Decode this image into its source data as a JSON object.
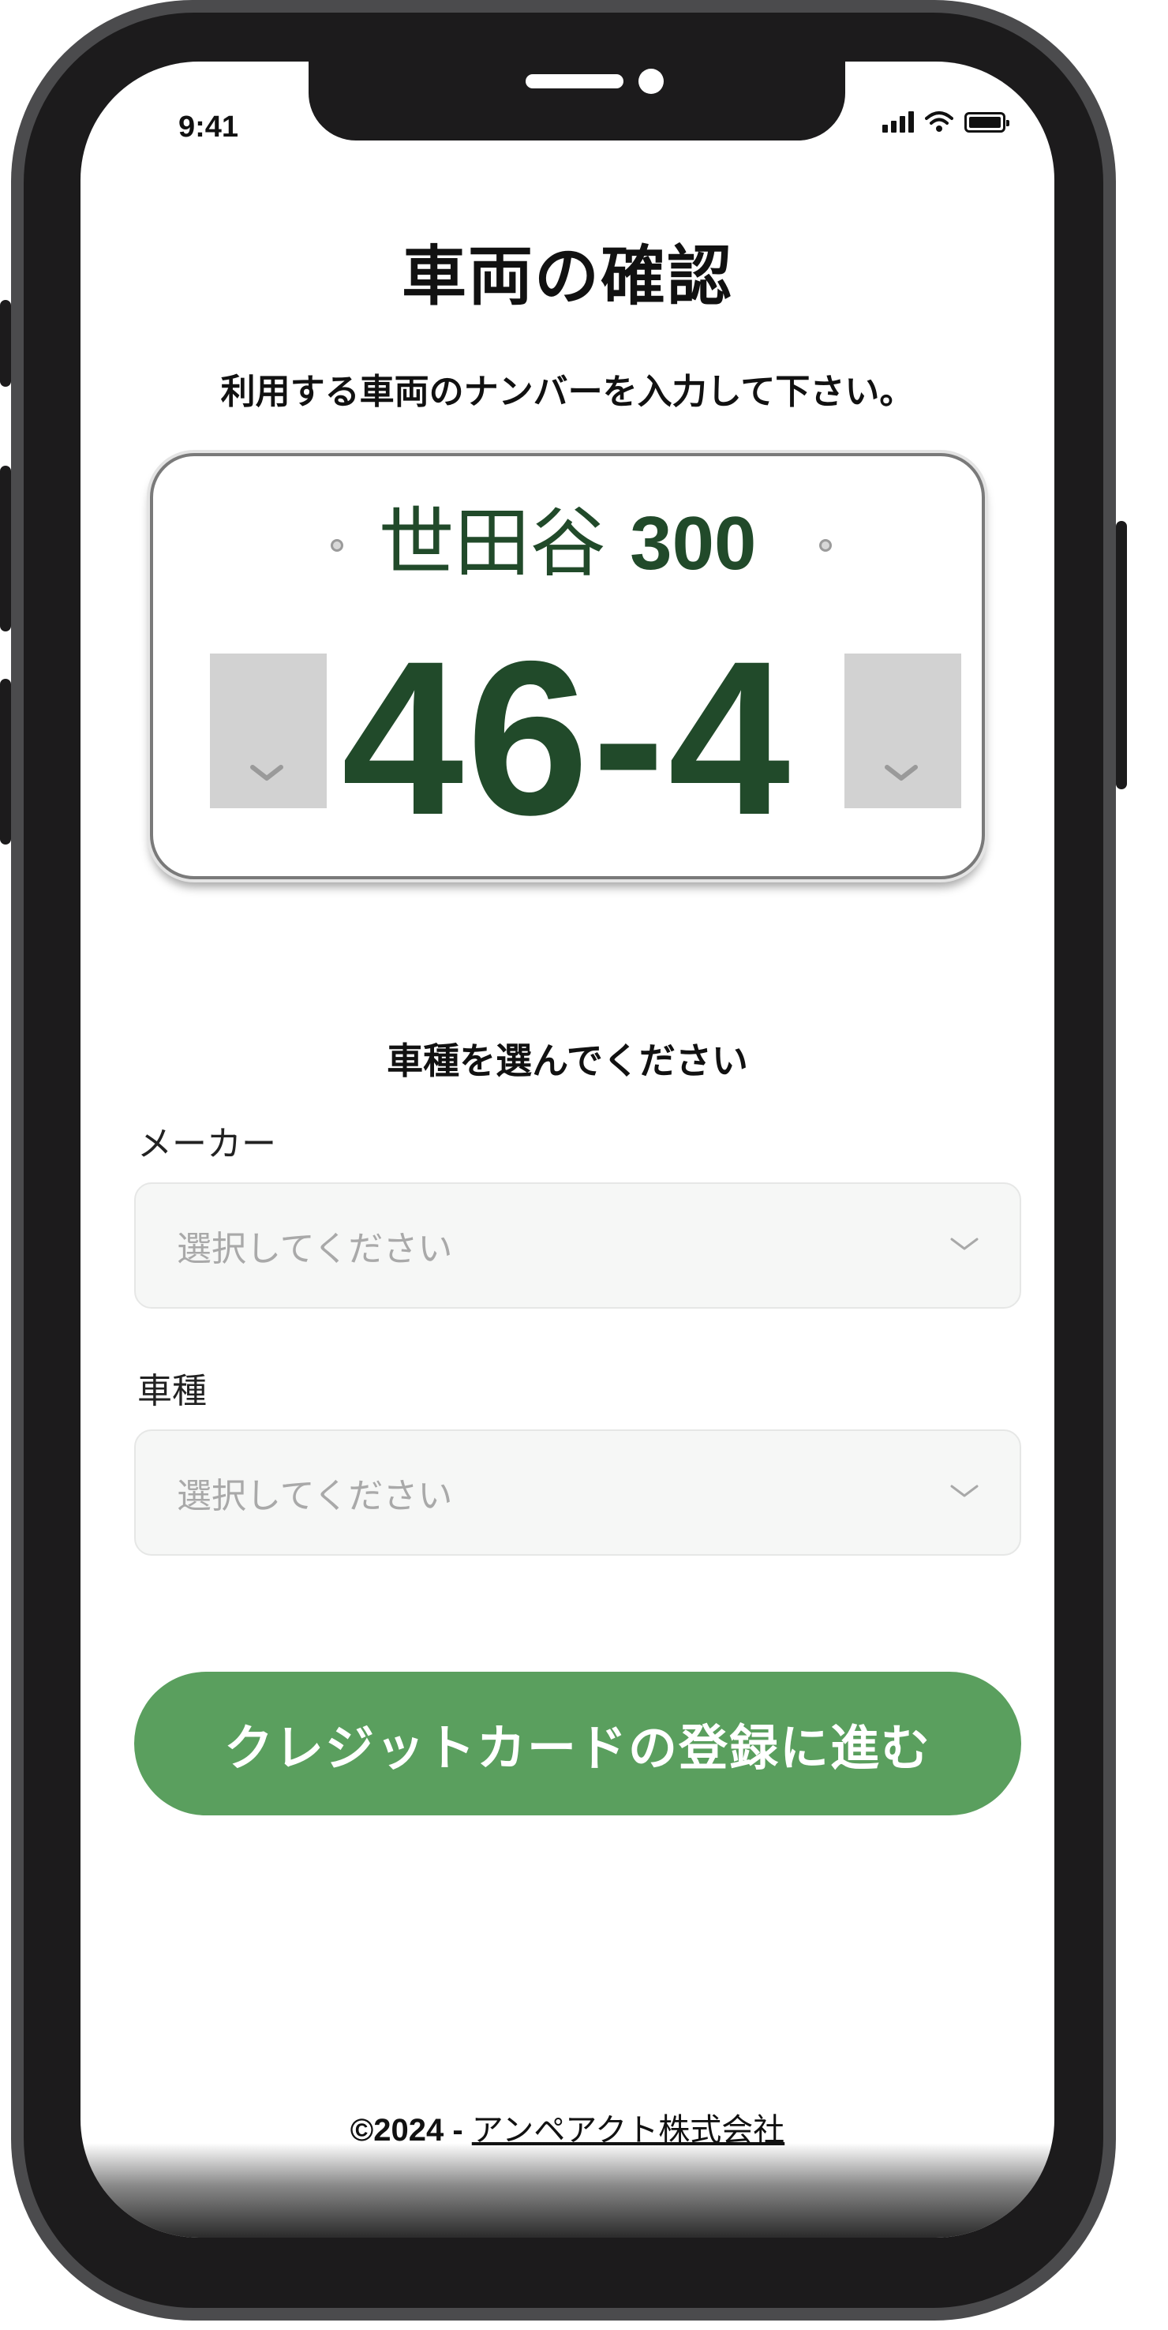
{
  "status_bar": {
    "time": "9:41"
  },
  "page_title": "車両の確認",
  "instruction": "利用する車両のナンバーを入力して下さい。",
  "plate": {
    "region": "世田谷",
    "class_number": "300",
    "main_number": "46-4"
  },
  "vehicle_section": {
    "title": "車種を選んでください",
    "maker": {
      "label": "メーカー",
      "placeholder": "選択してください"
    },
    "model": {
      "label": "車種",
      "placeholder": "選択してください"
    }
  },
  "primary_button": {
    "label": "クレジットカードの登録に進む"
  },
  "footer": {
    "copyright": "©2024 - ",
    "company": "アンペアクト株式会社"
  },
  "colors": {
    "accent_green": "#5a9f5e",
    "plate_text": "#214a2a",
    "phone_frame": "#4b4b4d"
  },
  "icons": [
    "signal-icon",
    "wifi-icon",
    "battery-icon",
    "chevron-down-icon"
  ]
}
